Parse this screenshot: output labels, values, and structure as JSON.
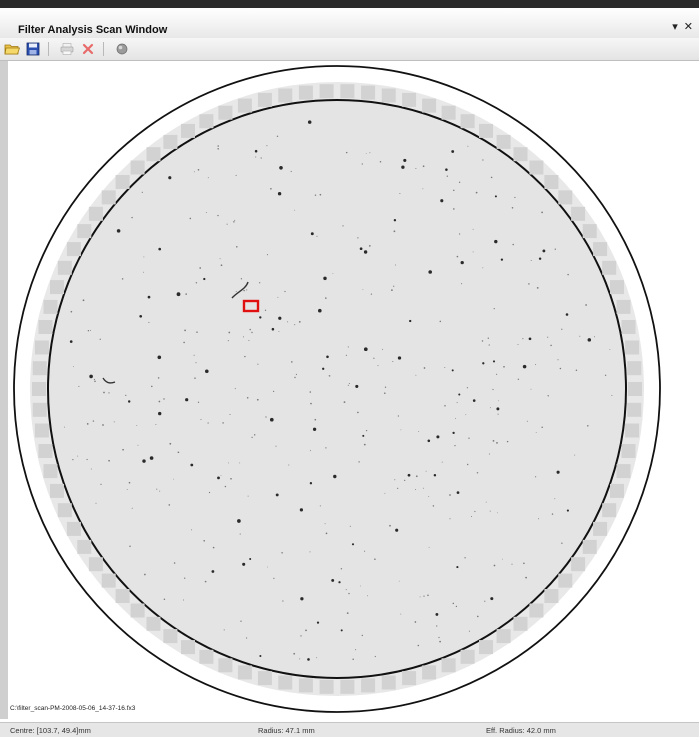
{
  "window": {
    "title": "Filter Analysis Scan Window",
    "dropdown_glyph": "▾",
    "close_glyph": "✕"
  },
  "toolbar": {
    "icons": [
      "open-folder-icon",
      "save-disk-icon",
      "print-icon",
      "delete-x-icon",
      "sphere-icon"
    ]
  },
  "viewer": {
    "file_path": "C:\\filter_scan-PM-2008-05-06_14-37-16.fx3"
  },
  "status": {
    "centre": "Centre: [103.7, 49.4]mm",
    "radius": "Radius: 47.1 mm",
    "eff_radius": "Eff. Radius: 42.0 mm"
  },
  "colors": {
    "disc_fill": "#e4e4e4",
    "ring_stroke": "#111111",
    "selection_box": "#e01010",
    "particles": "#2a2a2a"
  }
}
